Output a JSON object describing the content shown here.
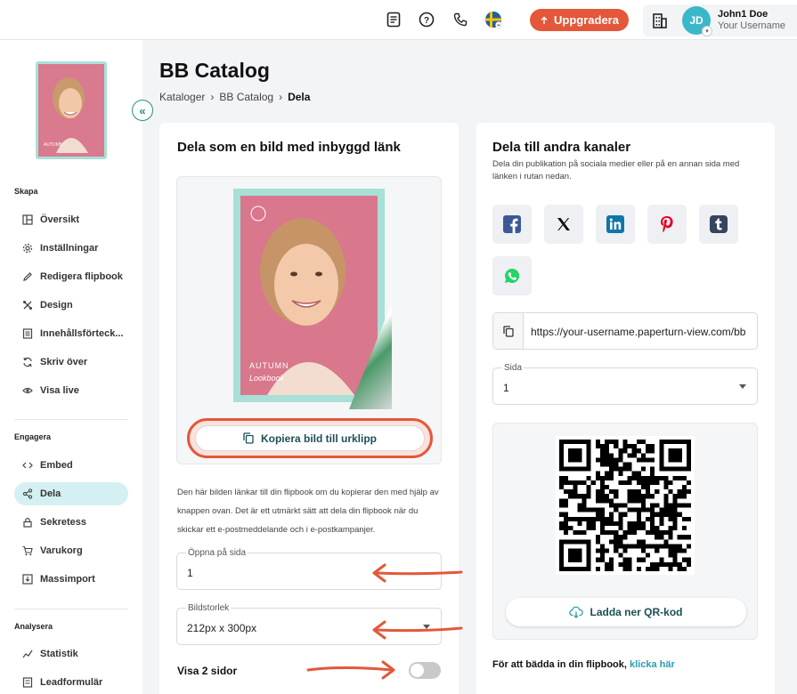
{
  "topbar": {
    "icons": [
      "document-icon",
      "help-icon",
      "phone-icon",
      "sweden-flag-icon",
      "building-icon"
    ],
    "upgrade_label": "Uppgradera",
    "user": {
      "initials": "JD",
      "name": "John1 Doe",
      "subtitle": "Your Username"
    }
  },
  "sidebar": {
    "sections": {
      "create": "Skapa",
      "engage": "Engagera",
      "analyze": "Analysera"
    },
    "create_items": [
      {
        "label": "Översikt",
        "icon": "overview-icon"
      },
      {
        "label": "Inställningar",
        "icon": "settings-icon"
      },
      {
        "label": "Redigera flipbook",
        "icon": "edit-icon"
      },
      {
        "label": "Design",
        "icon": "design-icon"
      },
      {
        "label": "Innehållsförteck...",
        "icon": "toc-icon"
      },
      {
        "label": "Skriv över",
        "icon": "overwrite-icon"
      },
      {
        "label": "Visa live",
        "icon": "eye-icon"
      }
    ],
    "engage_items": [
      {
        "label": "Embed",
        "icon": "code-icon"
      },
      {
        "label": "Dela",
        "icon": "share-icon",
        "active": true
      },
      {
        "label": "Sekretess",
        "icon": "lock-icon"
      },
      {
        "label": "Varukorg",
        "icon": "cart-icon"
      },
      {
        "label": "Massimport",
        "icon": "import-icon"
      }
    ],
    "analyze_items": [
      {
        "label": "Statistik",
        "icon": "stats-icon"
      },
      {
        "label": "Leadformulär",
        "icon": "form-icon"
      }
    ]
  },
  "header": {
    "title": "BB Catalog",
    "breadcrumb": [
      "Kataloger",
      "BB Catalog",
      "Dela"
    ]
  },
  "left_card": {
    "title": "Dela som en bild med inbyggd länk",
    "cover_text_1": "AUTUMN",
    "cover_text_2": "Lookbook",
    "copy_button": "Kopiera bild till urklipp",
    "help_text": "Den här bilden länkar till din flipbook om du kopierar den med hjälp av knappen ovan. Det är ett utmärkt sätt att dela din flipbook när du skickar ett e-postmeddelande och i e-postkampanjer.",
    "open_on_page": {
      "label": "Öppna på sida",
      "value": "1"
    },
    "image_size": {
      "label": "Bildstorlek",
      "value": "212px x 300px"
    },
    "show_two_pages": {
      "label": "Visa 2 sidor",
      "on": false
    }
  },
  "right_card": {
    "title": "Dela till andra kanaler",
    "subtitle": "Dela din publikation på sociala medier eller på en annan sida med länken i rutan nedan.",
    "socials": [
      {
        "name": "facebook-icon",
        "color": "#3b5998"
      },
      {
        "name": "x-icon",
        "color": "#111111"
      },
      {
        "name": "linkedin-icon",
        "color": "#0e76a8"
      },
      {
        "name": "pinterest-icon",
        "color": "#e60023"
      },
      {
        "name": "tumblr-icon",
        "color": "#35465c"
      },
      {
        "name": "whatsapp-icon",
        "color": "#25d366"
      }
    ],
    "url": "https://your-username.paperturn-view.com/bb",
    "page_select": {
      "label": "Sida",
      "value": "1"
    },
    "qr_download": "Ladda ner QR-kod",
    "embed_text": "För att bädda in din flipbook,",
    "embed_link": "klicka här"
  },
  "colors": {
    "accent": "#e4573a",
    "teal": "#2a9db0",
    "dark_teal": "#1c4f57",
    "active_bg": "#d4f0f2"
  }
}
